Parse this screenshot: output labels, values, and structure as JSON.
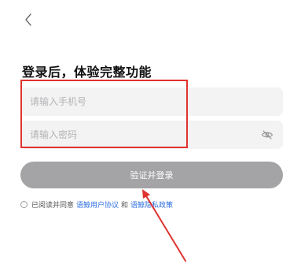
{
  "header": {
    "title": "登录后，体验完整功能"
  },
  "form": {
    "phone_placeholder": "请输入手机号",
    "password_placeholder": "请输入密码",
    "submit_label": "验证并登录"
  },
  "agreement": {
    "prefix": "已阅读并同意",
    "user_agreement": "语鲸用户协议",
    "conjunction": "和",
    "privacy_policy": "语鲸隐私政策"
  },
  "icons": {
    "back": "chevron-left-icon",
    "password_toggle": "eye-slash-icon"
  },
  "colors": {
    "annotation": "#e0332f",
    "link": "#2f6fe0",
    "button": "#a4a4a6",
    "input_background": "#f3f3f4"
  }
}
